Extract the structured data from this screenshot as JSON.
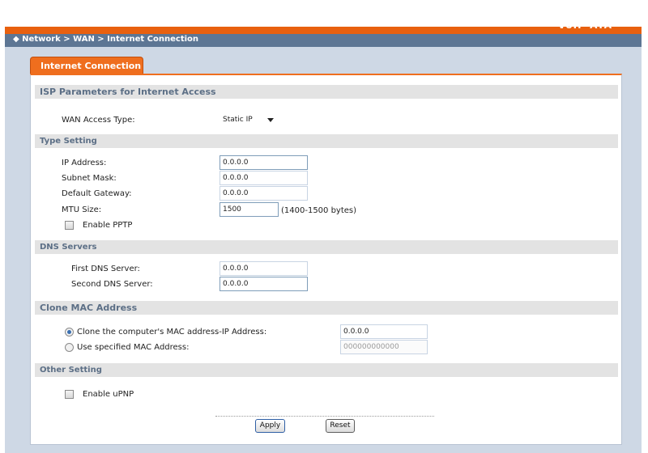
{
  "header": {
    "brand": "VoIP ATA",
    "breadcrumb": "◆ Network > WAN > Internet Connection"
  },
  "tab": {
    "label": "Internet Connection"
  },
  "isp": {
    "title": "ISP Parameters for Internet Access",
    "wan_access_type_label": "WAN Access Type:",
    "wan_access_type_value": "Static IP"
  },
  "type_setting": {
    "title": "Type Setting",
    "ip_label": "IP Address:",
    "ip_value": "0.0.0.0",
    "subnet_label": "Subnet Mask:",
    "subnet_value": "0.0.0.0",
    "gateway_label": "Default Gateway:",
    "gateway_value": "0.0.0.0",
    "mtu_label": "MTU Size:",
    "mtu_value": "1500",
    "mtu_hint": "(1400-1500 bytes)",
    "pptp_label": "Enable PPTP"
  },
  "dns": {
    "title": "DNS Servers",
    "first_label": "First DNS Server:",
    "first_value": "0.0.0.0",
    "second_label": "Second DNS Server:",
    "second_value": "0.0.0.0"
  },
  "clone_mac": {
    "title": "Clone MAC Address",
    "clone_label": "Clone the computer's MAC address-IP Address:",
    "clone_value": "0.0.0.0",
    "specified_label": "Use specified MAC Address:",
    "specified_value": "000000000000"
  },
  "other": {
    "title": "Other Setting",
    "upnp_label": "Enable uPNP"
  },
  "buttons": {
    "apply": "Apply",
    "reset": "Reset"
  }
}
